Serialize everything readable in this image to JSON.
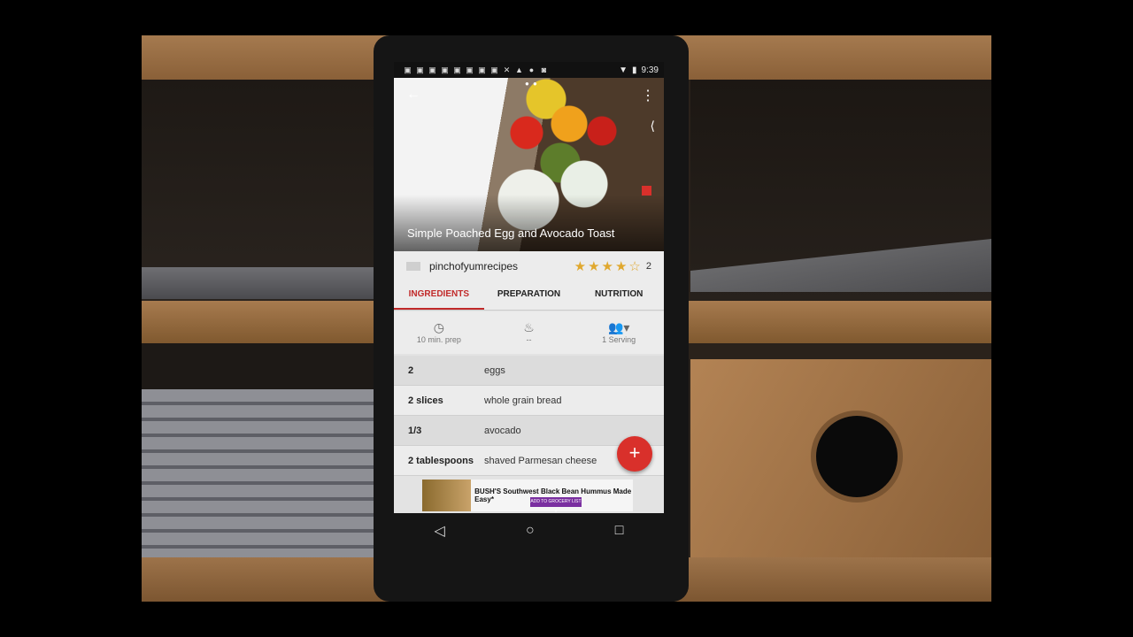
{
  "status": {
    "time": "9:39"
  },
  "recipe": {
    "title": "Simple Poached Egg and Avocado Toast",
    "author": "pinchofyumrecipes",
    "rating_value": 4,
    "rating_max": 5,
    "rating_count": "2"
  },
  "tabs": [
    "INGREDIENTS",
    "PREPARATION",
    "NUTRITION"
  ],
  "meta": {
    "prep": "10 min. prep",
    "cook": "--",
    "servings": "1 Serving"
  },
  "ingredients": [
    {
      "qty": "2",
      "name": "eggs"
    },
    {
      "qty": "2 slices",
      "name": "whole grain bread"
    },
    {
      "qty": "1/3",
      "name": "avocado"
    },
    {
      "qty": "2 tablespoons",
      "name": "shaved Parmesan cheese"
    }
  ],
  "ad": {
    "headline": "BUSH'S Southwest Black Bean Hummus Made Easy*",
    "button": "ADD TO GROCERY LIST »"
  },
  "fab_label": "+",
  "colors": {
    "accent": "#c12a2a",
    "fab": "#d9302b",
    "star": "#e0a82e"
  }
}
